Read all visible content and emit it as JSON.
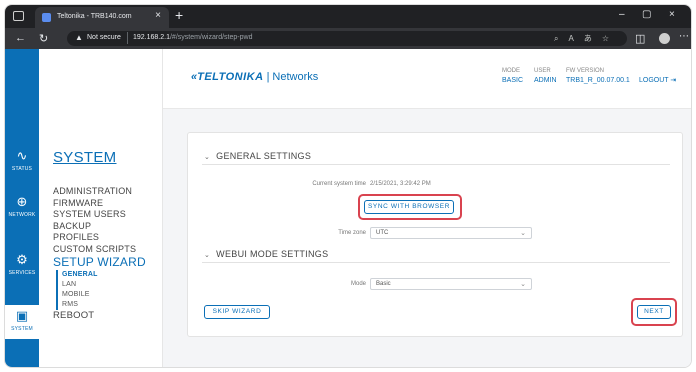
{
  "browser": {
    "tab_title": "Teltonika - TRB140.com",
    "tab_close": "×",
    "new_tab": "+",
    "win_min": "–",
    "win_max": "▢",
    "win_close": "×",
    "not_secure": "Not secure",
    "url_host": "192.168.2.1",
    "url_path": "/#/system/wizard/step-pwd"
  },
  "rail": {
    "items": [
      {
        "label": "STATUS",
        "icon": "activity-icon"
      },
      {
        "label": "NETWORK",
        "icon": "globe-icon"
      },
      {
        "label": "SERVICES",
        "icon": "gear-icon"
      },
      {
        "label": "SYSTEM",
        "icon": "device-icon"
      }
    ]
  },
  "sidebar": {
    "title": "SYSTEM",
    "items": [
      "ADMINISTRATION",
      "FIRMWARE",
      "SYSTEM USERS",
      "BACKUP",
      "PROFILES",
      "CUSTOM SCRIPTS"
    ],
    "wizard_label": "SETUP WIZARD",
    "wizard_steps": [
      "GENERAL",
      "LAN",
      "MOBILE",
      "RMS"
    ],
    "wizard_selected": "GENERAL",
    "reboot": "REBOOT"
  },
  "header": {
    "brand": "TELTONIKA",
    "brand_suffix": "Networks",
    "mode_label": "MODE",
    "mode_value": "BASIC",
    "user_label": "USER",
    "user_value": "ADMIN",
    "fw_label": "FW VERSION",
    "fw_value": "TRB1_R_00.07.00.1",
    "logout": "LOGOUT"
  },
  "general": {
    "heading": "GENERAL SETTINGS",
    "time_label": "Current system time",
    "time_value": "2/15/2021, 3:29:42 PM",
    "sync_button": "SYNC WITH BROWSER",
    "timezone_label": "Time zone",
    "timezone_value": "UTC"
  },
  "webui": {
    "heading": "WEBUI MODE SETTINGS",
    "mode_label": "Mode",
    "mode_value": "Basic"
  },
  "actions": {
    "skip": "SKIP WIZARD",
    "next": "NEXT"
  },
  "colors": {
    "accent": "#0b6fb6",
    "highlight": "#d9434f"
  }
}
